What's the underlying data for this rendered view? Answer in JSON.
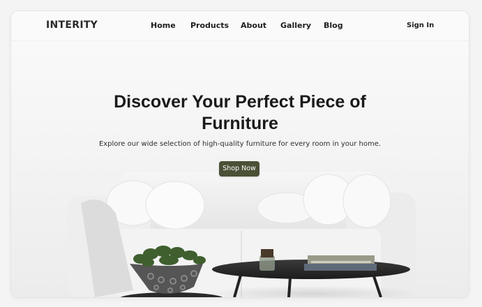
{
  "nav": {
    "brand": "INTERITY",
    "items": [
      {
        "label": "Home"
      },
      {
        "label": "Products"
      },
      {
        "label": "About"
      },
      {
        "label": "Gallery"
      },
      {
        "label": "Blog"
      }
    ],
    "sign_in": "Sign In"
  },
  "hero": {
    "title_line1": "Discover Your Perfect Piece of",
    "title_line2": "Furniture",
    "subtitle": "Explore our wide selection of high-quality furniture for every room in your home.",
    "cta_label": "Shop Now"
  },
  "colors": {
    "cta_background": "#4a5137",
    "text_dark": "#1a1a1a"
  }
}
